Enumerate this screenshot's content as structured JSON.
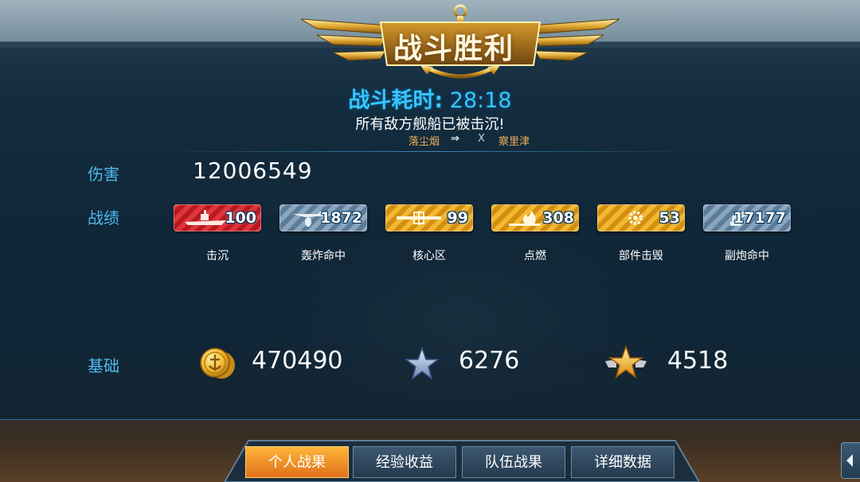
{
  "header": {
    "title": "战斗胜利",
    "time_label": "战斗耗时:",
    "time_value": "28:18",
    "result_text": "所有敌方舰船已被击沉!"
  },
  "versus": {
    "ally": "落尘烟",
    "symbol": "⇒",
    "cross": "X",
    "enemy": "察里津"
  },
  "damage": {
    "label": "伤害",
    "value": "12006549"
  },
  "record": {
    "label": "战绩",
    "items": [
      {
        "label": "击沉",
        "value": "100",
        "style": "red",
        "icon": "warship-sink-icon"
      },
      {
        "label": "轰炸命中",
        "value": "1872",
        "style": "blue",
        "icon": "bomber-plane-icon"
      },
      {
        "label": "核心区",
        "value": "99",
        "style": "gold",
        "icon": "citadel-hit-icon"
      },
      {
        "label": "点燃",
        "value": "308",
        "style": "gold",
        "icon": "fire-icon"
      },
      {
        "label": "部件击毁",
        "value": "53",
        "style": "gold",
        "icon": "gear-destroy-icon"
      },
      {
        "label": "副炮命中",
        "value": "17177",
        "style": "blue",
        "icon": "secondary-gun-icon"
      }
    ]
  },
  "basic": {
    "label": "基础",
    "coins": "470490",
    "exp": "6276",
    "rank_exp": "4518"
  },
  "tabs": [
    {
      "label": "个人战果",
      "active": true
    },
    {
      "label": "经验收益",
      "active": false
    },
    {
      "label": "队伍战果",
      "active": false
    },
    {
      "label": "详细数据",
      "active": false
    }
  ],
  "colors": {
    "accent_blue": "#35c6ff",
    "label_blue": "#4fb9f0",
    "tab_active": "#f0901f",
    "medal_red": "#c8202a",
    "medal_blue": "#6d8fae",
    "medal_gold": "#e3a21a"
  }
}
